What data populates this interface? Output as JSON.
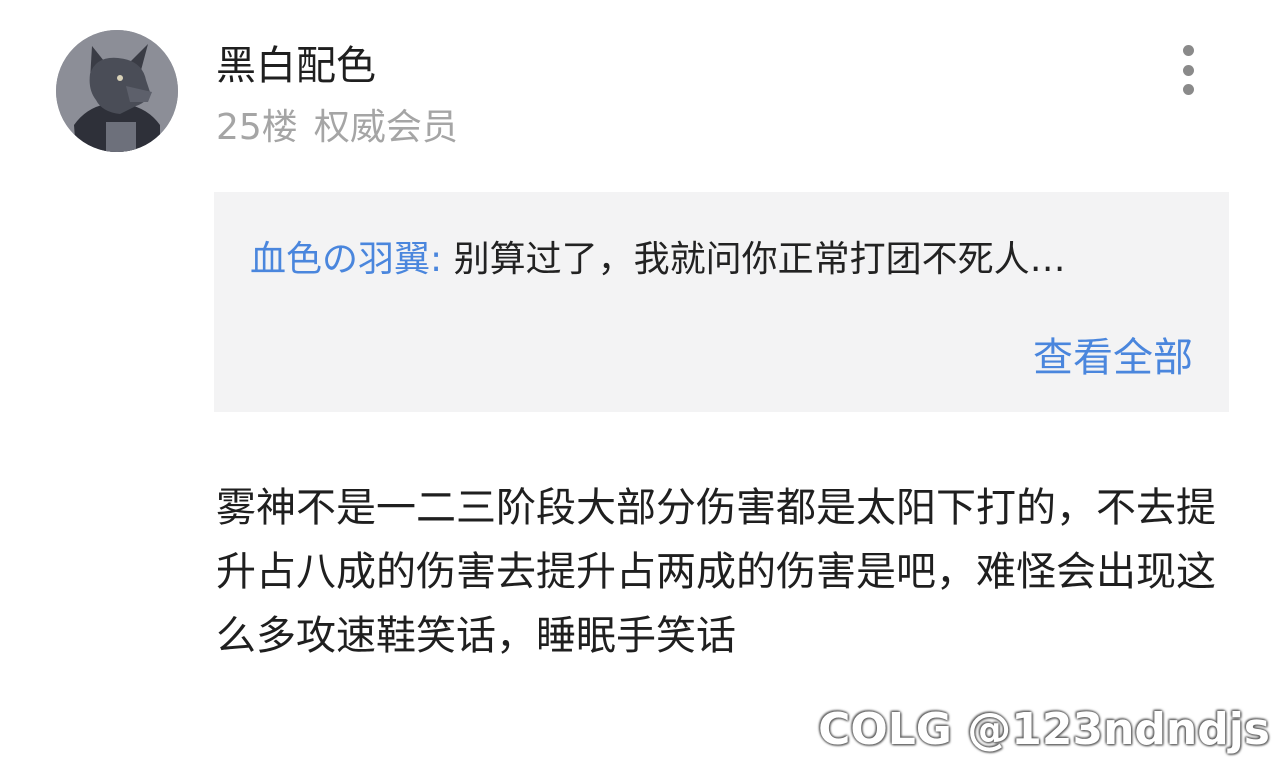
{
  "post": {
    "username": "黑白配色",
    "floor": "25楼",
    "badge": "权威会员",
    "more_icon": "more-vertical-icon",
    "quote": {
      "author": "血色の羽翼:",
      "text": " 别算过了，我就问你正常打团不死人…",
      "view_all": "查看全部"
    },
    "content": "雾神不是一二三阶段大部分伤害都是太阳下打的，不去提升占八成的伤害去提升占两成的伤害是吧，难怪会出现这么多攻速鞋笑话，睡眠手笑话"
  },
  "watermark": "COLG @123ndndjs",
  "colors": {
    "accent": "#4a86dd",
    "meta": "#a5a5a5",
    "quote_bg": "#f3f3f4",
    "text": "#1f1f1f"
  }
}
